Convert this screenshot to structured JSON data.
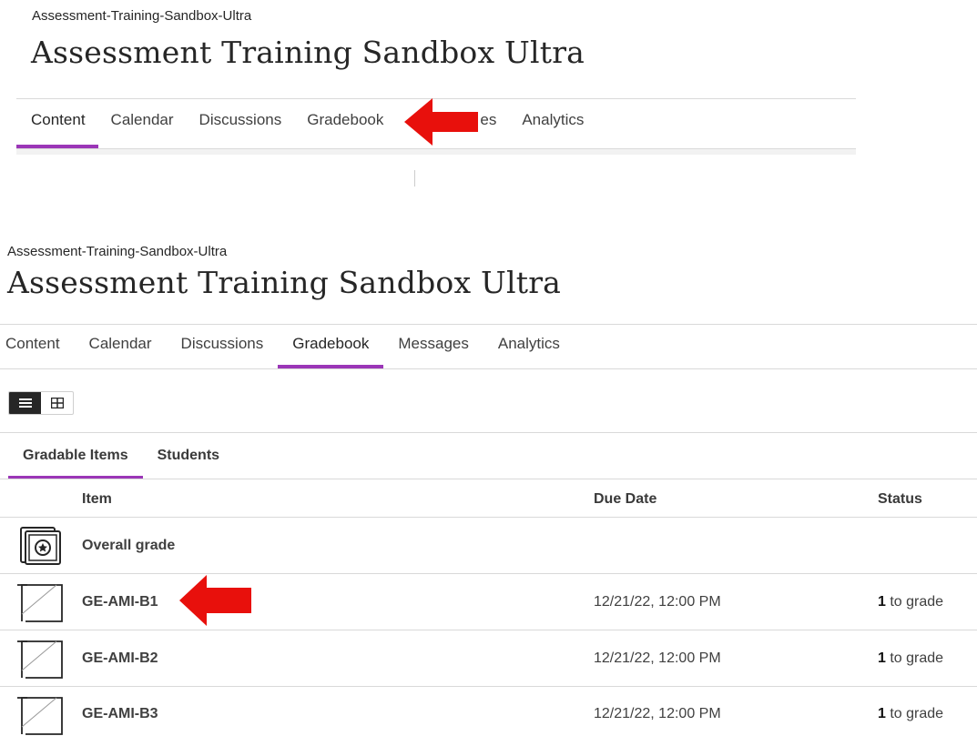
{
  "top_panel": {
    "course_id": "Assessment-Training-Sandbox-Ultra",
    "course_title": "Assessment Training Sandbox Ultra",
    "tabs": [
      {
        "label": "Content",
        "active": true
      },
      {
        "label": "Calendar",
        "active": false
      },
      {
        "label": "Discussions",
        "active": false
      },
      {
        "label": "Gradebook",
        "active": false
      },
      {
        "label": "Messages",
        "active": false
      },
      {
        "label": "Analytics",
        "active": false
      }
    ],
    "messages_visible_fragment": "es"
  },
  "bottom_panel": {
    "course_id": "Assessment-Training-Sandbox-Ultra",
    "course_title": "Assessment Training Sandbox Ultra",
    "tabs": [
      {
        "label": "Content",
        "active": false
      },
      {
        "label": "Calendar",
        "active": false
      },
      {
        "label": "Discussions",
        "active": false
      },
      {
        "label": "Gradebook",
        "active": true
      },
      {
        "label": "Messages",
        "active": false
      },
      {
        "label": "Analytics",
        "active": false
      }
    ],
    "view_toggle": {
      "list_icon": "list-view-icon",
      "grid_icon": "grid-view-icon",
      "selected": "list"
    },
    "sub_tabs": [
      {
        "label": "Gradable Items",
        "active": true
      },
      {
        "label": "Students",
        "active": false
      }
    ],
    "table": {
      "headers": {
        "item": "Item",
        "due_date": "Due Date",
        "status": "Status"
      },
      "rows": [
        {
          "icon": "overall-grade-icon",
          "name": "Overall grade",
          "due_date": "",
          "status_count": "",
          "status_text": ""
        },
        {
          "icon": "assignment-icon",
          "name": "GE-AMI-B1",
          "due_date": "12/21/22, 12:00 PM",
          "status_count": "1",
          "status_text": " to grade"
        },
        {
          "icon": "assignment-icon",
          "name": "GE-AMI-B2",
          "due_date": "12/21/22, 12:00 PM",
          "status_count": "1",
          "status_text": " to grade"
        },
        {
          "icon": "assignment-icon",
          "name": "GE-AMI-B3",
          "due_date": "12/21/22, 12:00 PM",
          "status_count": "1",
          "status_text": " to grade"
        }
      ]
    }
  },
  "annotations": {
    "arrow_color": "#e8100c",
    "arrows": [
      "arrow-pointing-gradebook-tab",
      "arrow-pointing-ge-ami-b1"
    ]
  },
  "colors": {
    "accent": "#9b36b7",
    "text": "#262626",
    "divider": "#d9d9d9"
  }
}
